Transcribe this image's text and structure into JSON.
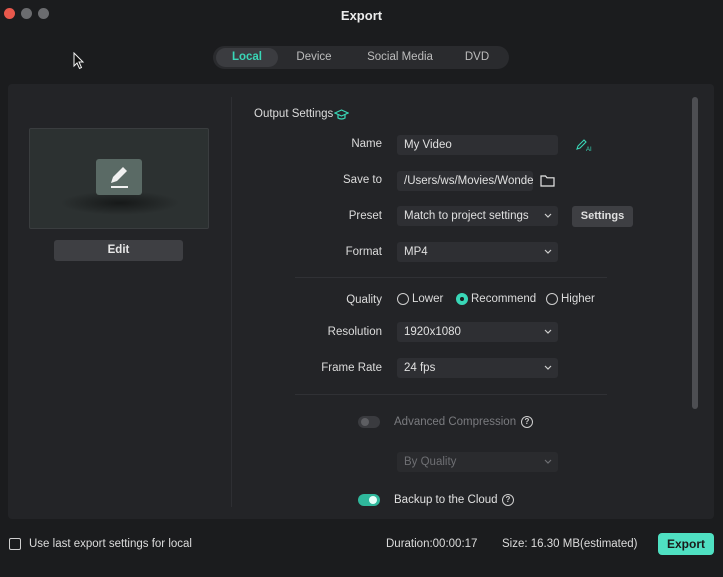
{
  "window": {
    "title": "Export"
  },
  "tabs": [
    {
      "label": "Local",
      "active": true
    },
    {
      "label": "Device",
      "active": false
    },
    {
      "label": "Social Media",
      "active": false
    },
    {
      "label": "DVD",
      "active": false
    }
  ],
  "preview": {
    "edit_label": "Edit"
  },
  "output": {
    "section_title": "Output Settings",
    "name_label": "Name",
    "name_value": "My Video",
    "save_to_label": "Save to",
    "save_to_value": "/Users/ws/Movies/Wonder",
    "preset_label": "Preset",
    "preset_value": "Match to project settings",
    "settings_label": "Settings",
    "format_label": "Format",
    "format_value": "MP4",
    "quality_label": "Quality",
    "quality_options": [
      "Lower",
      "Recommend",
      "Higher"
    ],
    "quality_selected": "Recommend",
    "resolution_label": "Resolution",
    "resolution_value": "1920x1080",
    "frame_rate_label": "Frame Rate",
    "frame_rate_value": "24 fps",
    "advanced_compression_label": "Advanced Compression",
    "advanced_compression_on": false,
    "by_quality_value": "By Quality",
    "backup_label": "Backup to the Cloud",
    "backup_on": true
  },
  "footer": {
    "use_last_label": "Use last export settings for local",
    "use_last_checked": false,
    "duration": "Duration:00:00:17",
    "size": "Size: 16.30 MB(estimated)",
    "export_label": "Export"
  },
  "colors": {
    "accent": "#39d7b7",
    "export_button": "#4fe0c2",
    "background": "#1b1c1e",
    "panel": "#232427"
  },
  "icons": [
    "folder-icon",
    "ai-rename-icon",
    "graduation-cap-icon",
    "chevron-down-icon",
    "help-icon",
    "pencil-icon"
  ]
}
